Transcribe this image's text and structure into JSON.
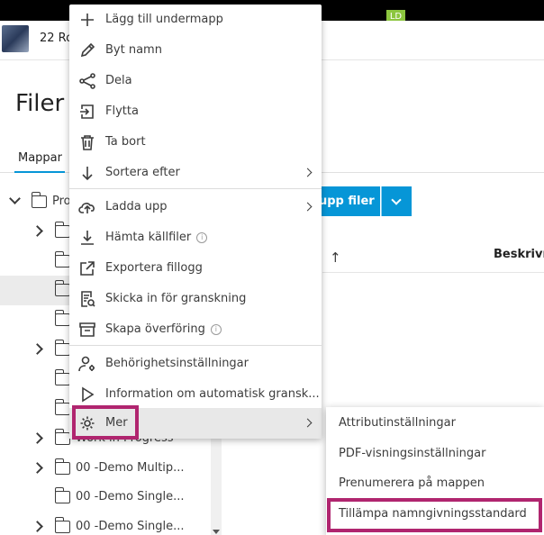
{
  "header": {
    "project_name": "22 Ro",
    "user_initials": "LD"
  },
  "page": {
    "title": "Filer",
    "tab_folders": "Mappar"
  },
  "tree": {
    "items": [
      {
        "label": "Pro",
        "expanded": true
      },
      {
        "label": "",
        "expanded": false
      },
      {
        "label": "",
        "expanded": false
      },
      {
        "label": "",
        "selected": true
      },
      {
        "label": ""
      },
      {
        "label": "",
        "expanded": false
      },
      {
        "label": ""
      },
      {
        "label": ""
      },
      {
        "label": "Work in Progress",
        "expanded": false
      },
      {
        "label": "00 -Demo Multip...",
        "expanded": false
      },
      {
        "label": "00 -Demo Single..."
      },
      {
        "label": "00 -Demo Single...",
        "expanded": false
      }
    ]
  },
  "toolbar": {
    "upload_label": "upp filer"
  },
  "table": {
    "column_description": "Beskrivni"
  },
  "menu": {
    "items": [
      {
        "label": "Lägg till undermapp",
        "icon": "plus-icon"
      },
      {
        "label": "Byt namn",
        "icon": "pencil-icon"
      },
      {
        "label": "Dela",
        "icon": "share-icon"
      },
      {
        "label": "Flytta",
        "icon": "move-icon"
      },
      {
        "label": "Ta bort",
        "icon": "trash-icon"
      },
      {
        "label": "Sortera efter",
        "icon": "arrow-down-icon",
        "submenu": true
      },
      {
        "label": "Ladda upp",
        "icon": "cloud-upload-icon",
        "submenu": true
      },
      {
        "label": "Hämta källfiler",
        "icon": "download-icon",
        "info": true
      },
      {
        "label": "Exportera fillogg",
        "icon": "export-icon"
      },
      {
        "label": "Skicka in för granskning",
        "icon": "review-icon"
      },
      {
        "label": "Skapa överföring",
        "icon": "archive-icon",
        "info": true
      },
      {
        "label": "Behörighetsinställningar",
        "icon": "user-gear-icon"
      },
      {
        "label": "Information om automatisk gransk...",
        "icon": "play-icon"
      },
      {
        "label": "Mer",
        "icon": "gear-icon",
        "submenu": true,
        "active": true
      }
    ],
    "info_glyph": "i"
  },
  "submenu": {
    "items": [
      {
        "label": "Attributinställningar"
      },
      {
        "label": "PDF-visningsinställningar"
      },
      {
        "label": "Prenumerera på mappen"
      },
      {
        "label": "Tillämpa namngivningsstandard"
      }
    ]
  },
  "colors": {
    "accent": "#0696d7",
    "highlight": "#b0256f",
    "badge": "#8cc63f"
  }
}
